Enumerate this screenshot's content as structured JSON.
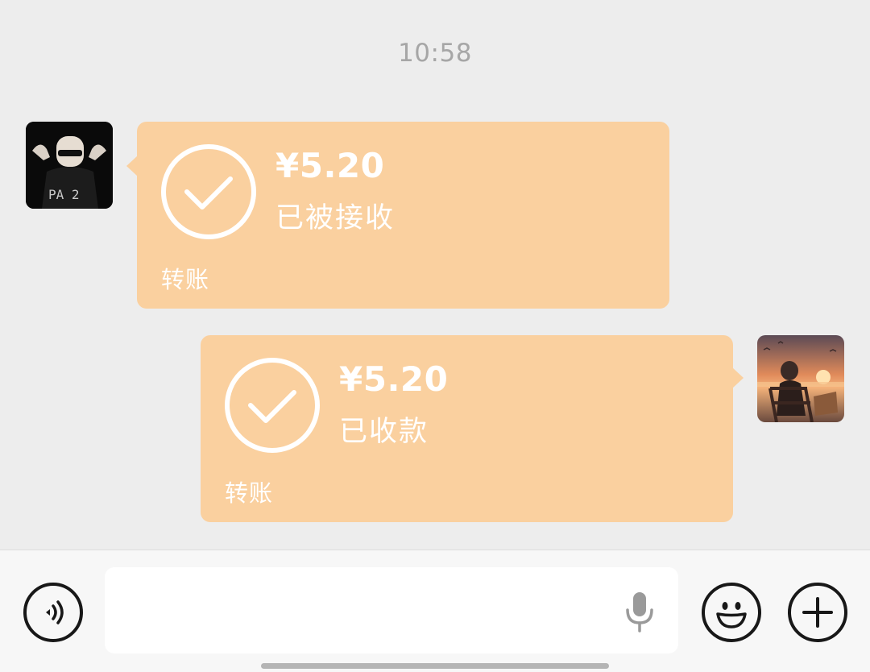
{
  "header": {
    "timestamp": "10:58"
  },
  "messages": [
    {
      "side": "left",
      "avatar": "avatar-dark-figure",
      "amount": "¥5.20",
      "status": "已被接收",
      "label": "转账",
      "icon": "check-circle-icon"
    },
    {
      "side": "right",
      "avatar": "avatar-sunset-scene",
      "amount": "¥5.20",
      "status": "已收款",
      "label": "转账",
      "icon": "check-circle-icon"
    }
  ],
  "input_bar": {
    "value": "",
    "placeholder": "",
    "icons": [
      "voice-icon",
      "microphone-icon",
      "emoji-icon",
      "plus-icon"
    ]
  },
  "colors": {
    "background": "#ededed",
    "transfer_bubble": "#fad09f",
    "toolbar": "#f7f7f7",
    "text_on_bubble": "#ffffff",
    "timestamp": "#a6a6a6"
  }
}
